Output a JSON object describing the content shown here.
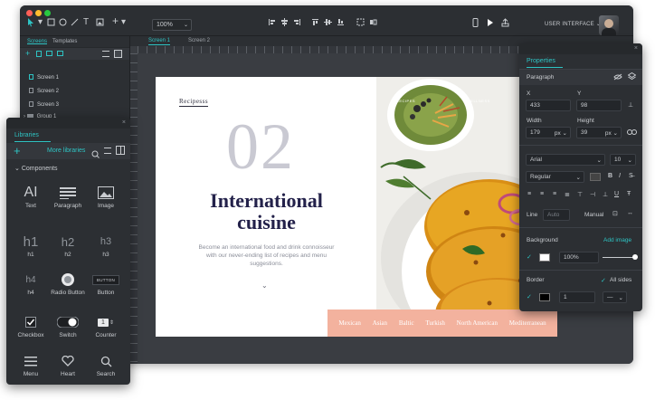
{
  "toolbar": {
    "zoom": "100%",
    "workspace_label": "USER INTERFACE",
    "window_dot_colors": [
      "#ff5f57",
      "#febc2e",
      "#28c840"
    ]
  },
  "left_panel": {
    "tabs": [
      "Screens",
      "Templates"
    ],
    "screens": [
      "Screen 1",
      "Screen 2",
      "Screen 3",
      "Group 1"
    ]
  },
  "canvas": {
    "tabs": [
      "Screen 1",
      "Screen 2"
    ]
  },
  "artboard": {
    "brand": "Recipesss",
    "number": "02",
    "heading_line1": "International",
    "heading_line2": "cuisine",
    "description": "Become an international food and drink connoisseur with our never-ending list of recipes and menu suggestions.",
    "top_nav": [
      "RECIPES",
      "WELLNESS"
    ],
    "nav_items": [
      "Mexican",
      "Asian",
      "Baltic",
      "Turkish",
      "North American",
      "Mediterranean"
    ],
    "nav_color": "#f3b29e"
  },
  "libraries": {
    "title": "Libraries",
    "more": "More libraries",
    "section": "Components",
    "components": [
      "Text",
      "Paragraph",
      "Image",
      "h1",
      "h2",
      "h3",
      "h4",
      "Radio Button",
      "Button",
      "Checkbox",
      "Switch",
      "Counter",
      "Menu",
      "Heart",
      "Search"
    ],
    "glyphs": {
      "text": "AI",
      "h1": "h1",
      "h2": "h2",
      "h3": "h3",
      "h4": "h4",
      "button": "BUTTON",
      "counter": "1"
    }
  },
  "properties": {
    "title": "Properties",
    "element": "Paragraph",
    "x_label": "X",
    "y_label": "Y",
    "x": "433",
    "y": "98",
    "width_label": "Width",
    "height_label": "Height",
    "width": "179",
    "width_unit": "px",
    "height": "39",
    "height_unit": "px",
    "font": "Arial",
    "font_size": "10",
    "weight": "Regular",
    "line_label": "Line",
    "line_value": "Auto",
    "manual_label": "Manual",
    "background_label": "Background",
    "add_image": "Add image",
    "bg_opacity": "100%",
    "border_label": "Border",
    "all_sides": "All sides",
    "border_width": "1",
    "accent": "#2ec4c4"
  }
}
